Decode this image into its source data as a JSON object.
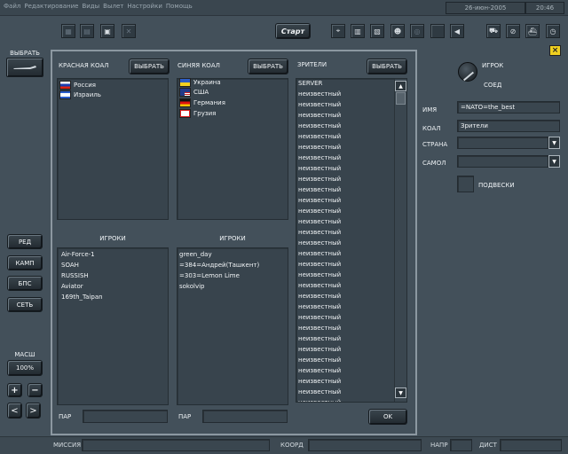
{
  "menubar": {
    "items": [
      "Файл",
      "Редактирование",
      "Виды",
      "Вылет",
      "Настройки",
      "Помощь"
    ],
    "date": "26-июн-2005",
    "time": "20:46"
  },
  "toolbar": {
    "start_label": "Старт"
  },
  "left_sidebar": {
    "select_label": "ВЫБРАТЬ",
    "modes": [
      "РЕД",
      "КАМП",
      "БПС",
      "СЕТЬ"
    ],
    "scale_label": "МАСШ",
    "zoom_value": "100%",
    "plus": "+",
    "minus": "−",
    "left": "<",
    "right": ">"
  },
  "dialog": {
    "red": {
      "title": "КРАСНАЯ КОАЛ",
      "select_label": "ВЫБРАТЬ",
      "countries": [
        {
          "name": "Россия"
        },
        {
          "name": "Израиль"
        }
      ],
      "players_header": "ИГРОКИ",
      "players": [
        "Air-Force-1",
        "SOAH",
        "RUSSISH",
        "Aviator",
        "169th_Taipan"
      ],
      "pair_label": "ПАР"
    },
    "blue": {
      "title": "СИНЯЯ КОАЛ",
      "select_label": "ВЫБРАТЬ",
      "countries": [
        {
          "name": "Украина"
        },
        {
          "name": "США"
        },
        {
          "name": "Германия"
        },
        {
          "name": "Грузия"
        }
      ],
      "players_header": "ИГРОКИ",
      "players": [
        "green_day",
        "=384=Андрей(Ташкент)",
        "=303=Lemon Lime",
        "sokolvip"
      ],
      "pair_label": "ПАР"
    },
    "spectators": {
      "title": "ЗРИТЕЛИ",
      "select_label": "ВЫБРАТЬ",
      "items": [
        "SERVER",
        "неизвестный",
        "неизвестный",
        "неизвестный",
        "неизвестный",
        "неизвестный",
        "неизвестный",
        "неизвестный",
        "неизвестный",
        "неизвестный",
        "неизвестный",
        "неизвестный",
        "неизвестный",
        "неизвестный",
        "неизвестный",
        "неизвестный",
        "неизвестный",
        "неизвестный",
        "неизвестный",
        "неизвестный",
        "неизвестный",
        "неизвестный",
        "неизвестный",
        "неизвестный",
        "неизвестный",
        "неизвестный",
        "неизвестный",
        "неизвестный",
        "неизвестный",
        "неизвестный",
        "неизвестный"
      ]
    },
    "ok_label": "OK"
  },
  "right_panel": {
    "knob_top": "ИГРОК",
    "knob_bottom": "СОЕД",
    "name_label": "ИМЯ",
    "name_value": "=NATO=the_best",
    "coal_label": "КОАЛ",
    "coal_value": "Зрители",
    "country_label": "СТРАНА",
    "country_value": "",
    "plane_label": "САМОЛ",
    "plane_value": "",
    "loadout_label": "ПОДВЕСКИ"
  },
  "bottombar": {
    "mission_label": "МИССИЯ",
    "coord_label": "КООРД",
    "heading_label": "НАПР",
    "dist_label": "ДИСТ"
  }
}
